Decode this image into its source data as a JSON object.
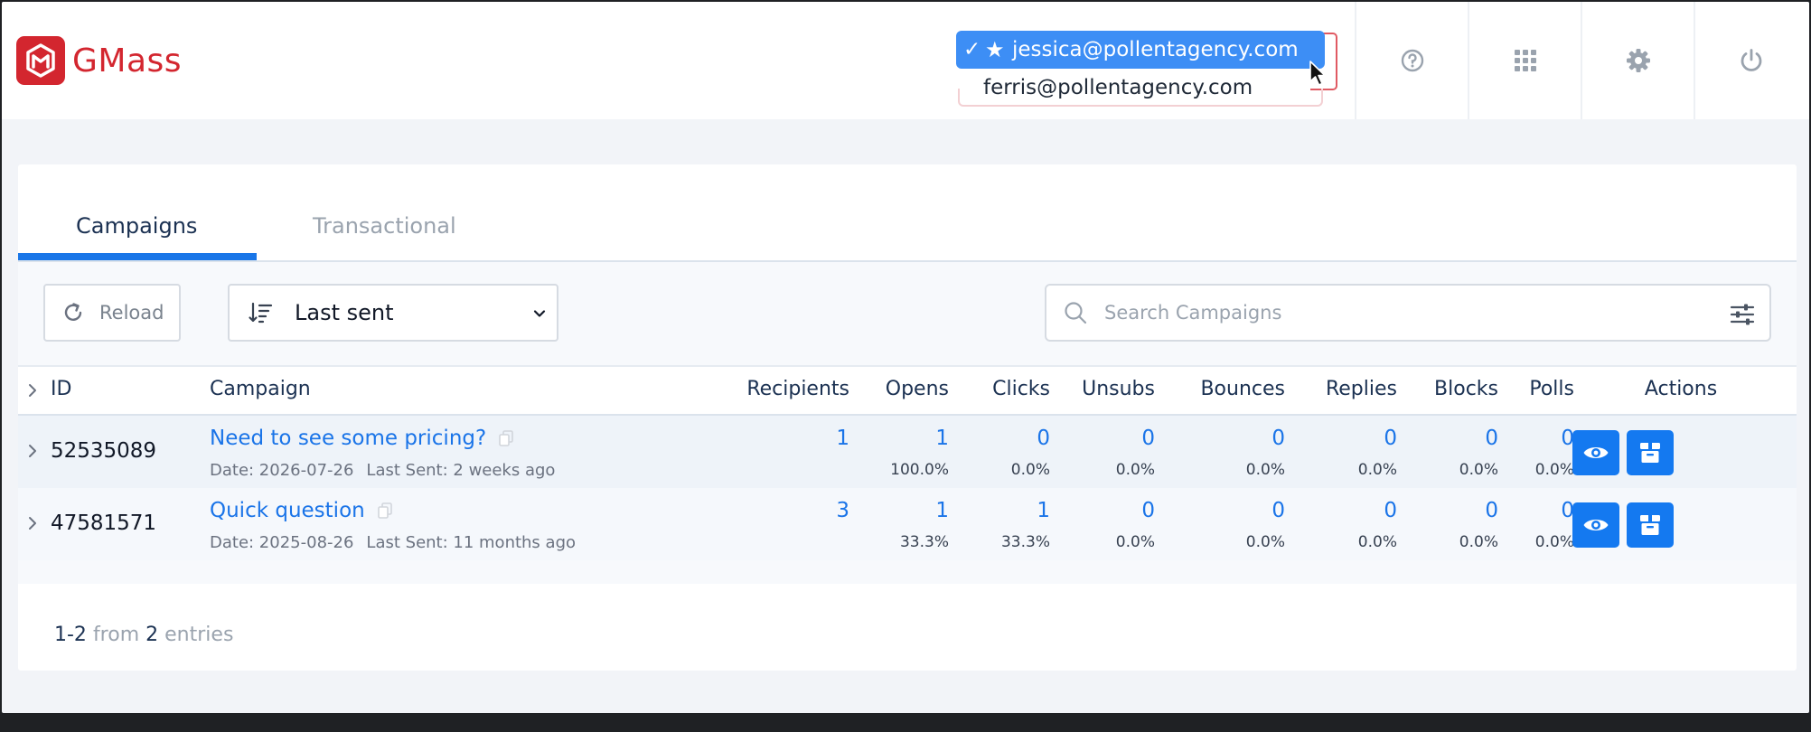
{
  "header": {
    "logo_text": "GMass",
    "accounts": [
      {
        "label": "jessica@pollentagency.com",
        "selected": true,
        "starred": true
      },
      {
        "label": "ferris@pollentagency.com",
        "selected": false,
        "starred": false
      }
    ],
    "icons": [
      "help-icon",
      "apps-grid-icon",
      "gear-icon",
      "power-icon"
    ]
  },
  "tabs": [
    {
      "label": "Campaigns",
      "active": true
    },
    {
      "label": "Transactional",
      "active": false
    }
  ],
  "toolbar": {
    "reload_label": "Reload",
    "sort_value": "Last sent",
    "search_placeholder": "Search Campaigns"
  },
  "table": {
    "columns": [
      "ID",
      "Campaign",
      "Recipients",
      "Opens",
      "Clicks",
      "Unsubs",
      "Bounces",
      "Replies",
      "Blocks",
      "Polls",
      "Actions"
    ],
    "rows": [
      {
        "id": "52535089",
        "campaign": "Need to see some pricing?",
        "date": "Date: 2026-07-26",
        "last_sent": "Last Sent: 2 weeks ago",
        "recipients": "1",
        "opens": "1",
        "opens_pct": "100.0%",
        "clicks": "0",
        "clicks_pct": "0.0%",
        "unsubs": "0",
        "unsubs_pct": "0.0%",
        "bounces": "0",
        "bounces_pct": "0.0%",
        "replies": "0",
        "replies_pct": "0.0%",
        "blocks": "0",
        "blocks_pct": "0.0%",
        "polls": "0",
        "polls_pct": "0.0%"
      },
      {
        "id": "47581571",
        "campaign": "Quick question",
        "date": "Date: 2025-08-26",
        "last_sent": "Last Sent: 11 months ago",
        "recipients": "3",
        "opens": "1",
        "opens_pct": "33.3%",
        "clicks": "1",
        "clicks_pct": "33.3%",
        "unsubs": "0",
        "unsubs_pct": "0.0%",
        "bounces": "0",
        "bounces_pct": "0.0%",
        "replies": "0",
        "replies_pct": "0.0%",
        "blocks": "0",
        "blocks_pct": "0.0%",
        "polls": "0",
        "polls_pct": "0.0%"
      }
    ]
  },
  "footer": {
    "range": "1-2",
    "from": "from",
    "total": "2",
    "entries": "entries"
  },
  "colors": {
    "brand_red": "#d3262f",
    "accent_blue": "#1479f0",
    "link_blue": "#1a74e8",
    "selection_blue": "#3d8ef5"
  }
}
